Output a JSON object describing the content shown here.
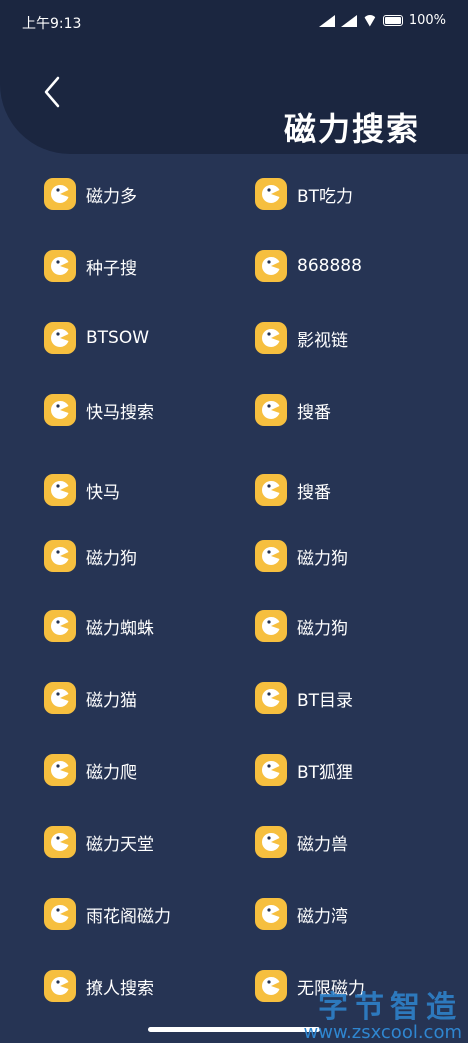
{
  "status": {
    "time": "上午9:13",
    "battery": "100%"
  },
  "header": {
    "title": "磁力搜索"
  },
  "items": [
    {
      "label": "磁力多"
    },
    {
      "label": "BT吃力"
    },
    {
      "label": "种子搜"
    },
    {
      "label": "868888"
    },
    {
      "label": "BTSOW"
    },
    {
      "label": "影视链"
    },
    {
      "label": "快马搜索"
    },
    {
      "label": "搜番"
    },
    {
      "label": "快马"
    },
    {
      "label": "搜番"
    },
    {
      "label": "磁力狗"
    },
    {
      "label": "磁力狗"
    },
    {
      "label": "磁力蜘蛛"
    },
    {
      "label": "磁力狗"
    },
    {
      "label": "磁力猫"
    },
    {
      "label": "BT目录"
    },
    {
      "label": "磁力爬"
    },
    {
      "label": "BT狐狸"
    },
    {
      "label": "磁力天堂"
    },
    {
      "label": "磁力兽"
    },
    {
      "label": "雨花阁磁力"
    },
    {
      "label": "磁力湾"
    },
    {
      "label": "撩人搜索"
    },
    {
      "label": "无限磁力"
    }
  ],
  "watermark": {
    "text": "字节智造",
    "url": "www.zsxcool.com"
  },
  "colors": {
    "background": "#263454",
    "header": "#1b2640",
    "icon": "#f6bf3f"
  },
  "icon_name": "pacman-icon"
}
